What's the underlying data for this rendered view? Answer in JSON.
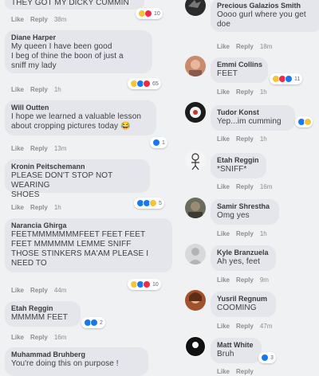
{
  "left": [
    {
      "author": "",
      "text": "THEY GOT MY DICKY CUMMIN",
      "like": "Like",
      "reply": "Reply",
      "time": "38m",
      "count": "10"
    },
    {
      "author": "Diane Harper",
      "text": "My queen I have been good\nI beg of thine the boon of just a\nsniff my lady",
      "like": "Like",
      "reply": "Reply",
      "time": "1h",
      "count": "65"
    },
    {
      "author": "Will Outten",
      "text": "I hope we learned a valuable lesson\nabout cropping pictures today 😂",
      "like": "Like",
      "reply": "Reply",
      "time": "13m",
      "count": "1"
    },
    {
      "author": "Kronin Peitschemann",
      "text": "PLEASE DON'T STOP NOT WEARING\nSHOES",
      "like": "Like",
      "reply": "Reply",
      "time": "1h",
      "count": "5"
    },
    {
      "author": "Narancia Ghirga",
      "text": "FEETMMMMMMMFEET FEET FEET\nFEET MMMMMM LEMME SNIFF\nTHOSE STINKERS MA'AM PLEASE I\nNEED TO",
      "like": "Like",
      "reply": "Reply",
      "time": "44m",
      "count": "10"
    },
    {
      "author": "Etah Reggin",
      "text": "MMMMM FEET",
      "like": "Like",
      "reply": "Reply",
      "time": "16m",
      "count": "2"
    },
    {
      "author": "Muhammad Bruhberg",
      "text": "You're doing this on purpose !",
      "like": "",
      "reply": "",
      "time": "",
      "count": ""
    }
  ],
  "right": [
    {
      "author": "Precious Galazios Smith",
      "text": "Oooo gurl where you get\ndoe",
      "like": "Like",
      "reply": "Reply",
      "time": "18m",
      "count": ""
    },
    {
      "author": "Emmi Collins",
      "text": "FEET",
      "like": "Like",
      "reply": "Reply",
      "time": "1h",
      "count": "11"
    },
    {
      "author": "Tudor Konst",
      "text": "Yep...im cumming",
      "like": "Like",
      "reply": "Reply",
      "time": "1h",
      "count": ""
    },
    {
      "author": "Etah Reggin",
      "text": "*SNIFF*",
      "like": "Like",
      "reply": "Reply",
      "time": "16m",
      "count": ""
    },
    {
      "author": "Samir Shrestha",
      "text": "Omg yes",
      "like": "Like",
      "reply": "Reply",
      "time": "1h",
      "count": ""
    },
    {
      "author": "Kyle Branzuela",
      "text": "Ah yes, feet",
      "like": "Like",
      "reply": "Reply",
      "time": "9m",
      "count": ""
    },
    {
      "author": "Yusril Regnum",
      "text": "COOMING",
      "like": "Like",
      "reply": "Reply",
      "time": "47m",
      "count": ""
    },
    {
      "author": "Matt White",
      "text": "Bruh",
      "like": "Like",
      "reply": "Reply",
      "time": "",
      "count": "3"
    }
  ],
  "colors": {
    "bubble": "#e4e6eb",
    "like_blue": "#1877f2",
    "haha_yellow": "#f5c33b",
    "love_red": "#f02849"
  }
}
